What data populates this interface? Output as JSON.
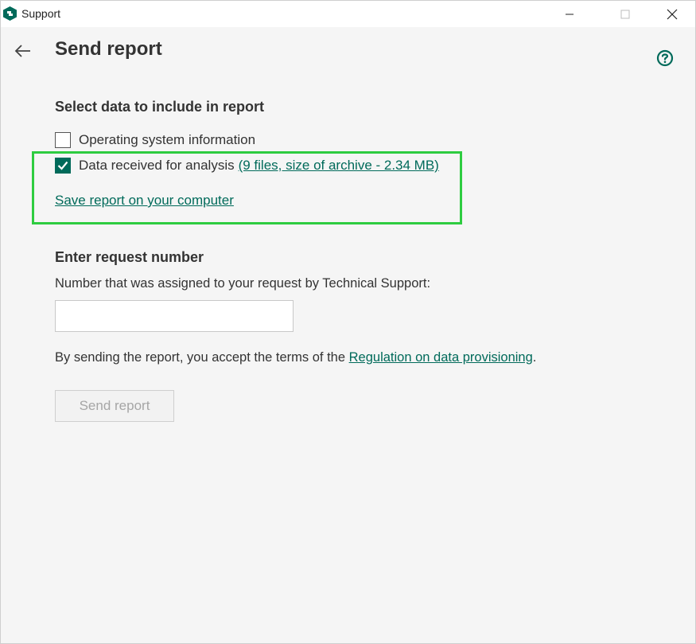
{
  "window": {
    "title": "Support",
    "controls": {
      "minimize": "–",
      "maximize": "□",
      "close": "✕"
    }
  },
  "header": {
    "title": "Send report",
    "back_icon": "arrow-left-icon",
    "help_icon": "question-circle-icon"
  },
  "select_section": {
    "title": "Select data to include in report",
    "options": [
      {
        "label": "Operating system information",
        "checked": false
      },
      {
        "label": "Data received for analysis",
        "checked": true,
        "link": "(9 files, size of archive - 2.34 MB)"
      }
    ],
    "save_link": "Save report on your computer"
  },
  "request_section": {
    "title": "Enter request number",
    "description": "Number that was assigned to your request by Technical Support:",
    "input_value": "",
    "input_placeholder": ""
  },
  "terms": {
    "prefix": "By sending the report, you accept the terms of the ",
    "link": "Regulation on data provisioning",
    "suffix": "."
  },
  "send_button": {
    "label": "Send report",
    "enabled": false
  },
  "colors": {
    "accent": "#006a5a",
    "highlight": "#2ecc40",
    "background": "#f5f5f5"
  }
}
